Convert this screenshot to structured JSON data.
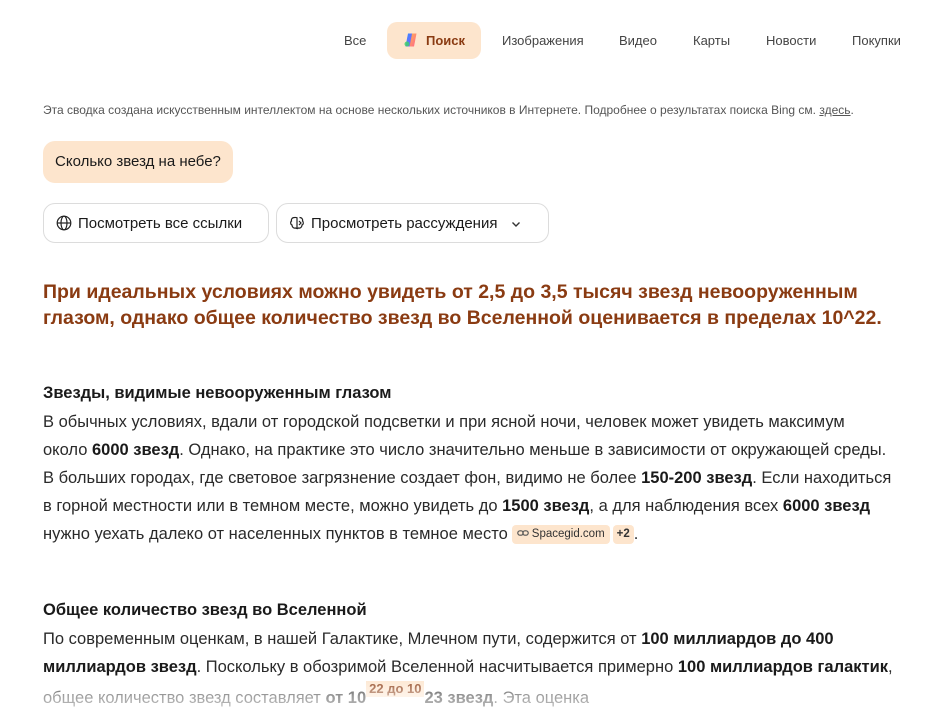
{
  "nav": {
    "tabs": [
      {
        "label": "Все"
      },
      {
        "label": "Поиск",
        "active": true
      },
      {
        "label": "Изображения"
      },
      {
        "label": "Видео"
      },
      {
        "label": "Карты"
      },
      {
        "label": "Новости"
      },
      {
        "label": "Покупки"
      }
    ]
  },
  "disclaimer": {
    "text": "Эта сводка создана искусственным интеллектом на основе нескольких источников в Интернете. Подробнее о результатах поиска Bing см.",
    "link": "здесь",
    "end": "."
  },
  "query": "Сколько звезд на небе?",
  "actions": {
    "links_label": "Посмотреть все ссылки",
    "reasoning_label": "Просмотреть рассуждения"
  },
  "headline": "При идеальных условиях можно увидеть от 2,5 до 3,5 тысяч звезд невооруженным глазом, однако общее количество звезд во Вселенной оценивается в пределах 10^22.",
  "section1": {
    "title": "Звезды, видимые невооруженным глазом",
    "t1": "В обычных условиях, вдали от городской подсветки и при ясной ночи, человек может увидеть максимум около ",
    "b1": "6000 звезд",
    "t2": ". Однако, на практике это число значительно меньше в зависимости от окружающей среды. В больших городах, где световое загрязнение создает фон, видимо не более ",
    "b2": "150-200 звезд",
    "t3": ". Если находиться в горной местности или в темном месте, можно увидеть до ",
    "b3": "1500 звезд",
    "t4": ", а для наблюдения всех ",
    "b4": "6000 звезд",
    "t5": " нужно уехать далеко от населенных пунктов в темное место",
    "cite": "Spacegid.com",
    "cite_more": "+2",
    "end": "."
  },
  "section2": {
    "title": "Общее количество звезд во Вселенной",
    "t1": "По современным оценкам, в нашей Галактике, Млечном пути, содержится от ",
    "b1": "100 миллиардов до 400 миллиардов звезд",
    "t2": ". Поскольку в обозримой Вселенной насчитывается примерно ",
    "b2": "100 миллиардов галактик",
    "t3": ", общее количество звезд составляет ",
    "b3": "от 10",
    "sup": "22 до 10",
    "b4": "23 звезд",
    "t4": ". Эта оценка"
  },
  "colors": {
    "accent_bg": "#fde5cd",
    "accent_text": "#8a3b12"
  }
}
